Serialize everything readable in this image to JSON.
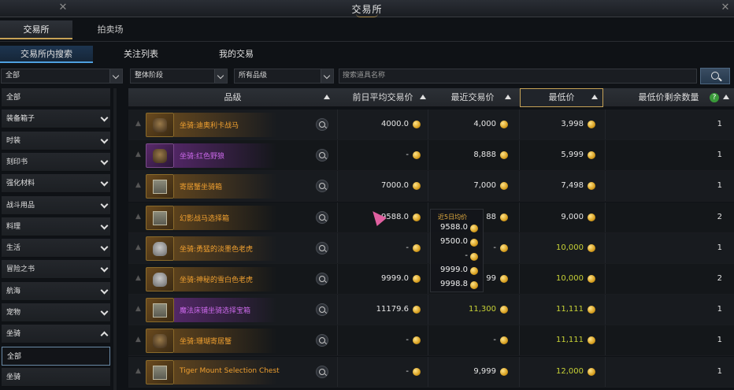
{
  "window": {
    "title": "交易所",
    "close_label": "✕"
  },
  "top_tabs": [
    {
      "label": "交易所",
      "active": true
    },
    {
      "label": "拍卖场",
      "active": false
    }
  ],
  "sub_tabs": [
    {
      "label": "交易所内搜索",
      "active": true
    },
    {
      "label": "关注列表",
      "active": false
    },
    {
      "label": "我的交易",
      "active": false
    }
  ],
  "filters": {
    "category": "全部",
    "tier": "整体阶段",
    "grade": "所有品级",
    "search_placeholder": "搜索道具名称"
  },
  "sidebar": {
    "items": [
      {
        "label": "全部",
        "chevron": "none"
      },
      {
        "label": "装备箱子",
        "chevron": "down"
      },
      {
        "label": "时装",
        "chevron": "down"
      },
      {
        "label": "刻印书",
        "chevron": "down"
      },
      {
        "label": "强化材料",
        "chevron": "down"
      },
      {
        "label": "战斗用品",
        "chevron": "down"
      },
      {
        "label": "料理",
        "chevron": "down"
      },
      {
        "label": "生活",
        "chevron": "down"
      },
      {
        "label": "冒险之书",
        "chevron": "down"
      },
      {
        "label": "航海",
        "chevron": "down"
      },
      {
        "label": "宠物",
        "chevron": "down"
      },
      {
        "label": "坐骑",
        "chevron": "up"
      },
      {
        "label": "全部",
        "chevron": "none",
        "selected": true
      },
      {
        "label": "坐骑",
        "chevron": "none"
      }
    ]
  },
  "table": {
    "headers": {
      "grade": "品级",
      "avg_price": "前日平均交易价",
      "recent_price": "最近交易价",
      "lowest_price": "最低价",
      "remaining": "最低价剩余数量",
      "help": "?"
    },
    "rows": [
      {
        "name": "坐骑:迪奥利卡战马",
        "name_color": "orange",
        "rarity": "gold",
        "icon": "mount-icon",
        "avg": "4000.0",
        "recent": "4,000",
        "recent_color": "white",
        "lowest": "3,998",
        "lowest_color": "white",
        "qty": "1"
      },
      {
        "name": "坐骑:红色野狼",
        "name_color": "purple",
        "rarity": "purple",
        "icon": "wolf-icon",
        "avg": "-",
        "recent": "8,888",
        "recent_color": "white",
        "lowest": "5,999",
        "lowest_color": "white",
        "qty": "1"
      },
      {
        "name": "寄居蟹坐骑箱",
        "name_color": "orange",
        "rarity": "gold",
        "icon": "chest-icon",
        "avg": "7000.0",
        "recent": "7,000",
        "recent_color": "white",
        "lowest": "7,498",
        "lowest_color": "white",
        "qty": "1"
      },
      {
        "name": "幻影战马选择箱",
        "name_color": "orange",
        "rarity": "gold",
        "icon": "chest-icon",
        "avg": "9588.0",
        "recent": "88",
        "recent_color": "white",
        "lowest": "9,000",
        "lowest_color": "white",
        "qty": "2"
      },
      {
        "name": "坐骑:勇猛的淡墨色老虎",
        "name_color": "orange",
        "rarity": "gold",
        "icon": "tiger-icon",
        "avg": "-",
        "recent": "-",
        "recent_color": "white",
        "lowest": "10,000",
        "lowest_color": "green",
        "qty": "1"
      },
      {
        "name": "坐骑:神秘的雪白色老虎",
        "name_color": "orange",
        "rarity": "gold",
        "icon": "tiger-icon",
        "avg": "9999.0",
        "recent": "99",
        "recent_color": "white",
        "lowest": "10,000",
        "lowest_color": "green",
        "qty": "2"
      },
      {
        "name": "魔法床铺坐骑选择宝箱",
        "name_color": "purple",
        "rarity": "gold",
        "icon": "chest-icon",
        "avg": "11179.6",
        "recent": "11,300",
        "recent_color": "green",
        "lowest": "11,111",
        "lowest_color": "green",
        "qty": "1"
      },
      {
        "name": "坐骑:珊瑚寄居蟹",
        "name_color": "orange",
        "rarity": "gold",
        "icon": "crab-icon",
        "avg": "-",
        "recent": "-",
        "recent_color": "white",
        "lowest": "11,111",
        "lowest_color": "green",
        "qty": "1"
      },
      {
        "name": "Tiger Mount Selection Chest",
        "name_color": "orange",
        "rarity": "gold",
        "icon": "chest-icon",
        "avg": "-",
        "recent": "9,999",
        "recent_color": "white",
        "lowest": "12,000",
        "lowest_color": "green",
        "qty": "1"
      }
    ]
  },
  "tooltip": {
    "title": "近5日均价",
    "values": [
      "9588.0",
      "9500.0",
      "-",
      "9999.0",
      "9998.8"
    ]
  },
  "colors": {
    "accent_gold": "#c6a256",
    "accent_blue": "#4ea0e0",
    "name_orange": "#f0a030",
    "name_purple": "#c968e8",
    "price_green": "#c8d236"
  }
}
